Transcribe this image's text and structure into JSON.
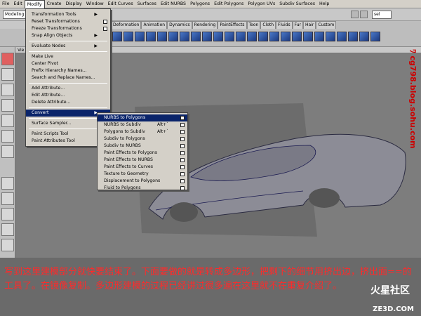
{
  "menubar": {
    "items": [
      "File",
      "Edit",
      "Modify",
      "Create",
      "Display",
      "Window",
      "Edit Curves",
      "Surfaces",
      "Edit NURBS",
      "Polygons",
      "Edit Polygons",
      "Polygon UVs",
      "Subdiv Surfaces",
      "Help"
    ],
    "active_index": 2
  },
  "toolbar": {
    "mode_combo": "Modeling",
    "sel_combo": "sel"
  },
  "shelf": {
    "tabs": [
      "Deformation",
      "Animation",
      "Dynamics",
      "Rendering",
      "PaintEffects",
      "Toon",
      "Cloth",
      "Fluids",
      "Fur",
      "Hair",
      "Custom"
    ],
    "icon_count": 24
  },
  "viewport": {
    "menu_label": "Vie"
  },
  "modify_menu": {
    "items": [
      {
        "label": "Transformation Tools",
        "submenu": true,
        "option": false
      },
      {
        "label": "Reset Transformations",
        "submenu": false,
        "option": true
      },
      {
        "label": "Freeze Transformations",
        "submenu": false,
        "option": true
      },
      {
        "label": "Snap Align Objects",
        "submenu": true,
        "option": false
      },
      {
        "sep": true
      },
      {
        "label": "Evaluate Nodes",
        "submenu": true,
        "option": false
      },
      {
        "sep": true
      },
      {
        "label": "Make Live",
        "submenu": false,
        "option": false
      },
      {
        "label": "Center Pivot",
        "submenu": false,
        "option": false
      },
      {
        "label": "Prefix Hierarchy Names...",
        "submenu": false,
        "option": false
      },
      {
        "label": "Search and Replace Names...",
        "submenu": false,
        "option": false
      },
      {
        "sep": true
      },
      {
        "label": "Add Attribute...",
        "submenu": false,
        "option": false
      },
      {
        "label": "Edit Attribute...",
        "submenu": false,
        "option": false
      },
      {
        "label": "Delete Attribute...",
        "submenu": false,
        "option": false
      },
      {
        "sep": true
      },
      {
        "label": "Convert",
        "submenu": true,
        "option": false,
        "highlighted": true
      },
      {
        "sep": true
      },
      {
        "label": "Surface Sampler...",
        "submenu": false,
        "option": true
      },
      {
        "sep": true
      },
      {
        "label": "Paint Scripts Tool",
        "submenu": false,
        "option": true
      },
      {
        "label": "Paint Attributes Tool",
        "submenu": false,
        "option": true
      }
    ]
  },
  "convert_menu": {
    "items": [
      {
        "label": "NURBS to Polygons",
        "shortcut": "",
        "highlighted": true
      },
      {
        "label": "NURBS to Subdiv",
        "shortcut": "Alt+`"
      },
      {
        "label": "Polygons to Subdiv",
        "shortcut": "Alt+`"
      },
      {
        "label": "Subdiv to Polygons",
        "shortcut": ""
      },
      {
        "label": "Subdiv to NURBS",
        "shortcut": ""
      },
      {
        "label": "Paint Effects to Polygons",
        "shortcut": ""
      },
      {
        "label": "Paint Effects to NURBS",
        "shortcut": ""
      },
      {
        "label": "Paint Effects to Curves",
        "shortcut": ""
      },
      {
        "label": "Texture to Geometry",
        "shortcut": ""
      },
      {
        "label": "Displacement to Polygons",
        "shortcut": ""
      },
      {
        "label": "Fluid to Polygons",
        "shortcut": ""
      }
    ]
  },
  "side": {
    "blog": "ﾜ cg798.blog.sohu.com"
  },
  "caption": {
    "text": "写到这里建模部分就快要结束了。下面要做的就是转成多边形，把剩下的细节用挤出边，挤出面==的工具了。在镜像复制。多边形建模的过程已经讲过很多遍在这里就不在重复介绍了。"
  },
  "logo": {
    "name": "火星社区",
    "url": "ZE3D.COM"
  },
  "colors": {
    "menu_highlight": "#0a246a",
    "caption_red": "#ff2a2a",
    "viewport_gray": "#7d7d7d"
  }
}
